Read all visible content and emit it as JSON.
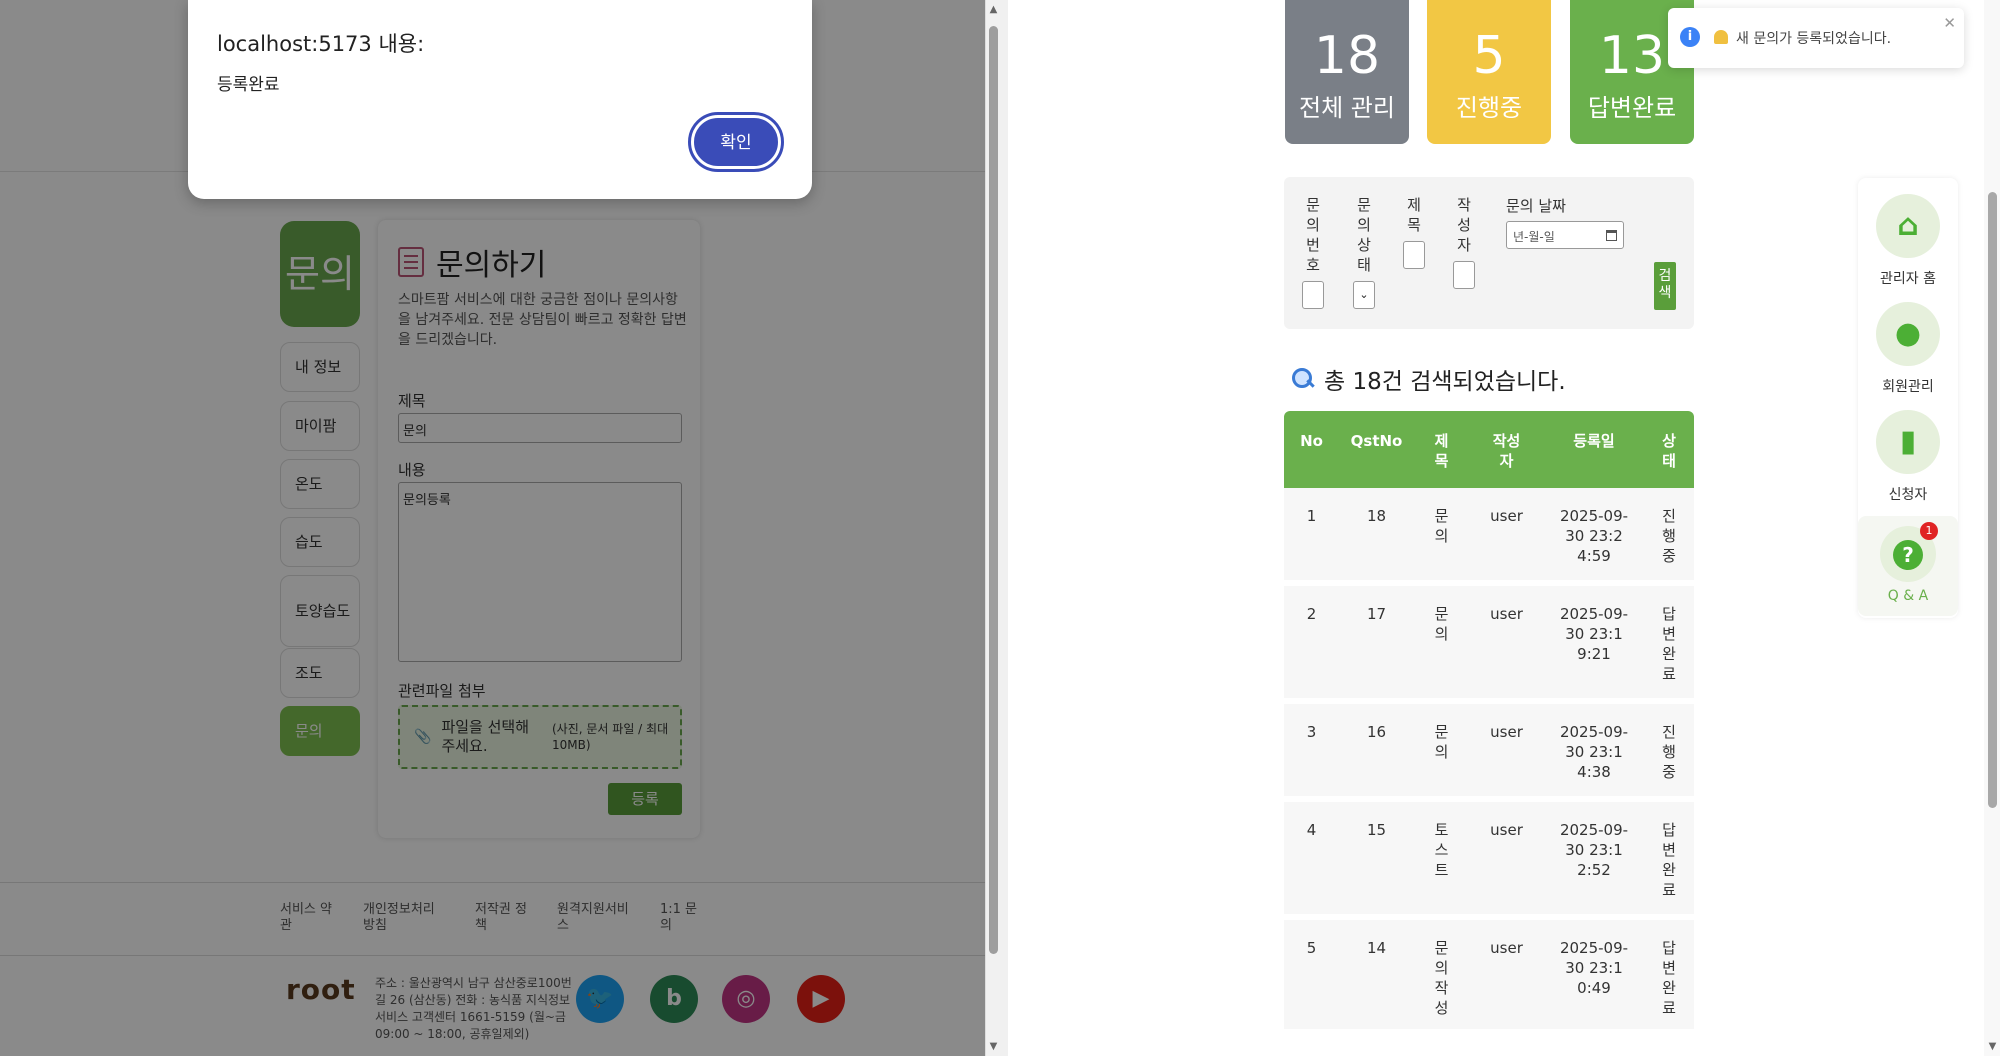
{
  "left": {
    "dialog": {
      "title": "localhost:5173 내용:",
      "message": "등록완료",
      "ok_label": "확인"
    },
    "sidebar": {
      "title": "문의",
      "items": [
        {
          "label": "내 정보"
        },
        {
          "label": "마이팜"
        },
        {
          "label": "온도"
        },
        {
          "label": "습도"
        },
        {
          "label": "토양습도"
        },
        {
          "label": "조도"
        },
        {
          "label": "문의"
        }
      ]
    },
    "form": {
      "title": "문의하기",
      "description": "스마트팜 서비스에 대한 궁금한 점이나 문의사항을 남겨주세요. 전문 상담팀이 빠르고 정확한 답변을 드리겠습니다.",
      "title_label": "제목",
      "title_value": "문의",
      "content_label": "내용",
      "content_value": "문의등록",
      "file_label": "관련파일 첨부",
      "file_button": "파일을 선택해주세요.",
      "file_hint": "(사진, 문서 파일 / 최대 10MB)",
      "submit_label": "등록"
    },
    "footer": {
      "links": [
        "서비스 약관",
        "개인정보처리방침",
        "저작권 정책",
        "원격지원서비스",
        "1:1 문의"
      ],
      "logo": "root",
      "address": "주소 : 울산광역시 남구 삼산중로100번길 26 (삼산동) 전화 : 농식품 지식정보서비스 고객센터 1661-5159 (월~금 09:00 ~ 18:00, 공휴일제외)",
      "social": [
        {
          "icon": "twitter-icon",
          "glyph": "🐦",
          "color": "#1da1f2"
        },
        {
          "icon": "bing-icon",
          "glyph": "b",
          "color": "#2e8b57"
        },
        {
          "icon": "instagram-icon",
          "glyph": "◎",
          "color": "#c13584"
        },
        {
          "icon": "youtube-icon",
          "glyph": "▶",
          "color": "#e62117"
        }
      ]
    }
  },
  "right": {
    "stats": [
      {
        "count": "18",
        "label": "전체 관리",
        "color": "#7a7f87"
      },
      {
        "count": "5",
        "label": "진행중",
        "color": "#f2c744"
      },
      {
        "count": "13",
        "label": "답변완료",
        "color": "#6ab04c"
      }
    ],
    "filters": {
      "labels": [
        "문의번호",
        "문의상태",
        "제목",
        "작성자"
      ],
      "date_label": "문의 날짜",
      "date_placeholder": "년-월-일",
      "search_label": "검색"
    },
    "result_text": "총 18건 검색되었습니다.",
    "table": {
      "headers": [
        "No",
        "QstNo",
        "제목",
        "작성자",
        "등록일",
        "상태"
      ],
      "rows": [
        {
          "no": "1",
          "qst": "18",
          "title": "문의",
          "writer": "user",
          "date": "2025-09-30 23:24:59",
          "status": "진행중"
        },
        {
          "no": "2",
          "qst": "17",
          "title": "문의",
          "writer": "user",
          "date": "2025-09-30 23:19:21",
          "status": "답변완료"
        },
        {
          "no": "3",
          "qst": "16",
          "title": "문의",
          "writer": "user",
          "date": "2025-09-30 23:14:38",
          "status": "진행중"
        },
        {
          "no": "4",
          "qst": "15",
          "title": "토스트",
          "writer": "user",
          "date": "2025-09-30 23:12:52",
          "status": "답변완료"
        },
        {
          "no": "5",
          "qst": "14",
          "title": "문의작성",
          "writer": "user",
          "date": "2025-09-30 23:10:49",
          "status": "답변완료"
        }
      ]
    },
    "nav": [
      {
        "label": "관리자 홈",
        "icon": "home-icon"
      },
      {
        "label": "회원관리",
        "icon": "user-icon"
      },
      {
        "label": "신청자",
        "icon": "clipboard-icon"
      },
      {
        "label": "Q & A",
        "icon": "question-icon",
        "badge": "1"
      }
    ],
    "toast": {
      "message": "새 문의가 등록되었습니다."
    }
  }
}
